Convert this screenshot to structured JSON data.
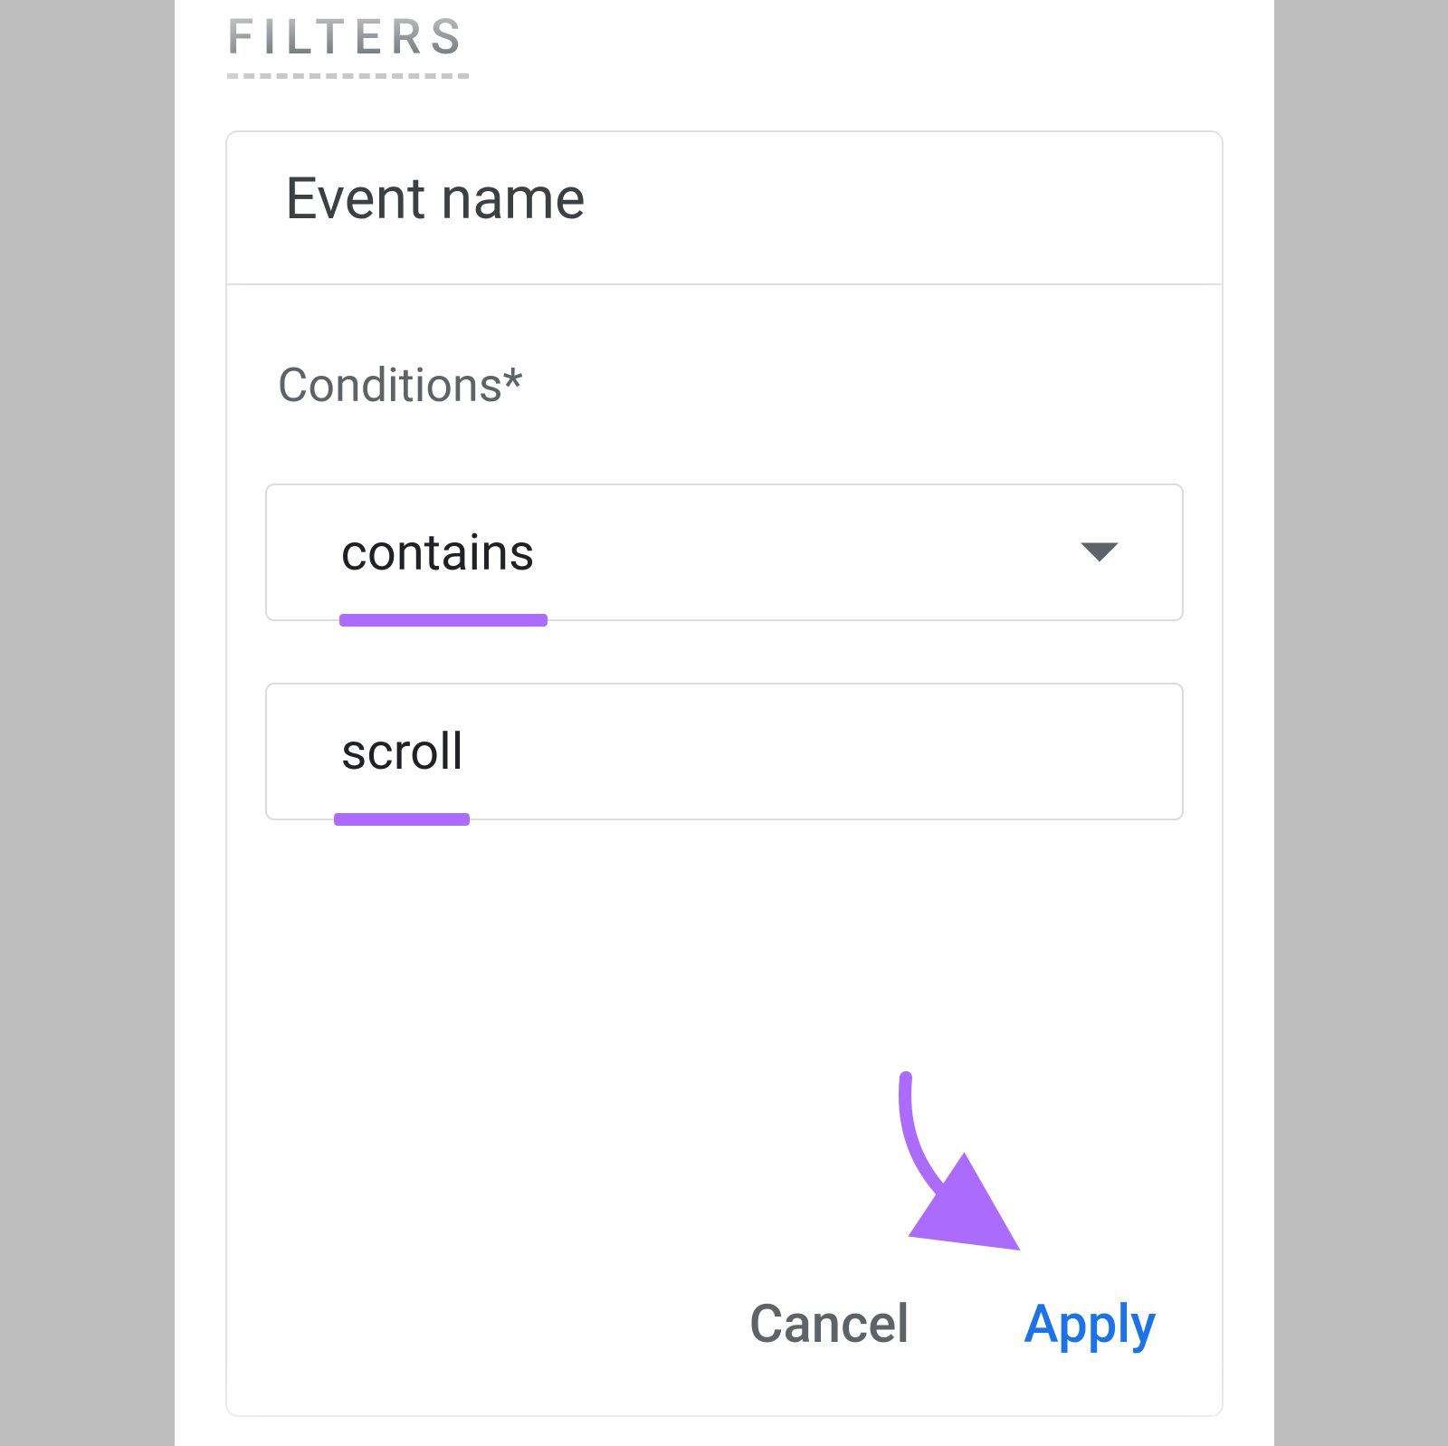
{
  "section": {
    "label": "FILTERS"
  },
  "card": {
    "title": "Event name",
    "conditions_label": "Conditions*",
    "dropdown": {
      "selected": "contains"
    },
    "input": {
      "value": "scroll"
    },
    "buttons": {
      "cancel": "Cancel",
      "apply": "Apply"
    }
  },
  "annotations": {
    "highlight_color": "#ab6cfe"
  }
}
